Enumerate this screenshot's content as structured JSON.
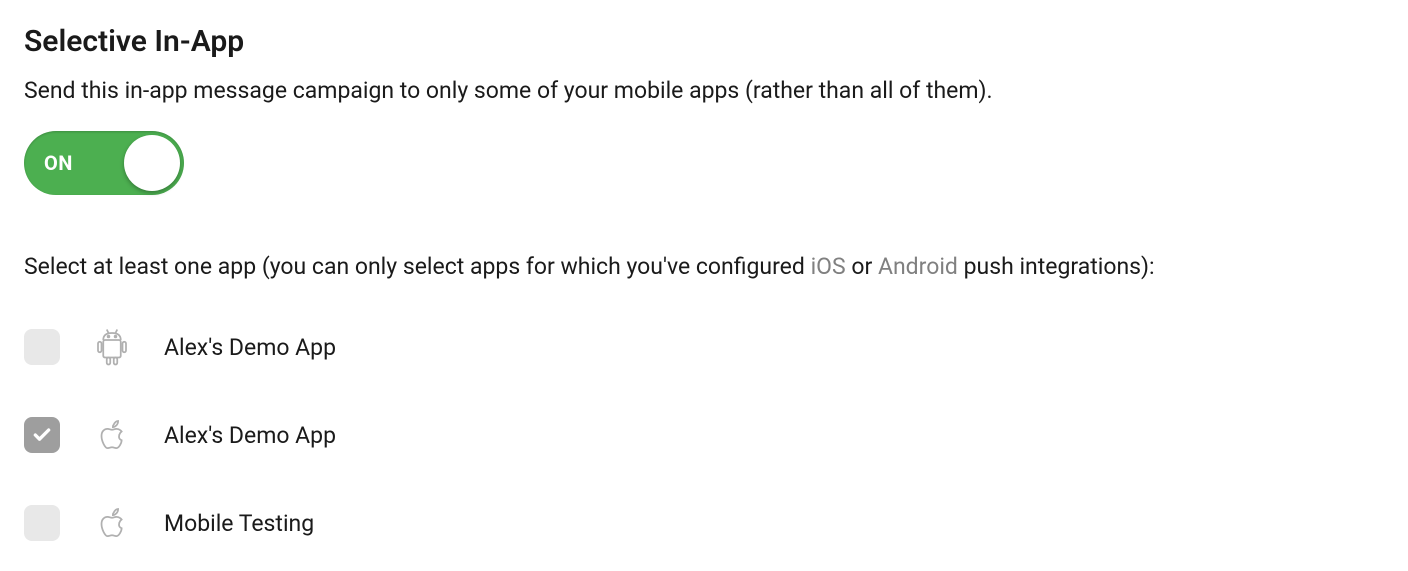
{
  "title": "Selective In-App",
  "description": "Send this in-app message campaign to only some of your mobile apps (rather than all of them).",
  "toggle": {
    "state": "ON",
    "enabled": true
  },
  "instruction": {
    "prefix": "Select at least one app (you can only select apps for which you've configured ",
    "ios_link": "iOS",
    "or": " or ",
    "android_link": "Android",
    "suffix": " push integrations):"
  },
  "apps": [
    {
      "name": "Alex's Demo App",
      "platform": "android",
      "checked": false
    },
    {
      "name": "Alex's Demo App",
      "platform": "ios",
      "checked": true
    },
    {
      "name": "Mobile Testing",
      "platform": "ios",
      "checked": false
    }
  ]
}
